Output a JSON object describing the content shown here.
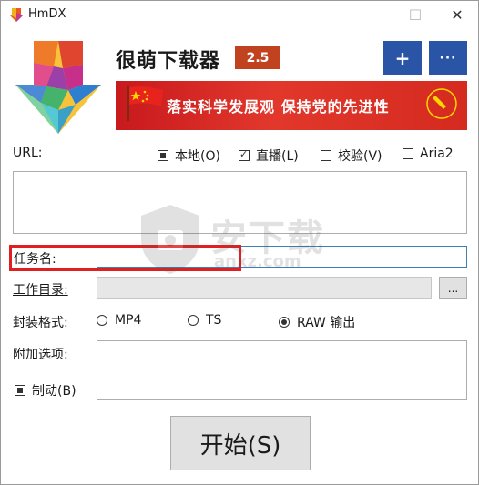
{
  "window": {
    "title": "HmDX",
    "minimize_glyph": "—",
    "maximize_glyph": "☐",
    "close_glyph": "✕"
  },
  "header": {
    "app_name": "很萌下载器",
    "version": "2.5",
    "plus_label": "+",
    "more_label": "···",
    "banner_text": "落实科学发展观 保持党的先进性"
  },
  "url": {
    "label": "URL:",
    "options": [
      {
        "label": "本地(O)",
        "state": "indeterminate"
      },
      {
        "label": "直播(L)",
        "state": "checked"
      },
      {
        "label": "校验(V)",
        "state": "unchecked"
      },
      {
        "label": "Aria2",
        "state": "unchecked"
      }
    ],
    "value": ""
  },
  "task": {
    "label": "任务名:",
    "value": ""
  },
  "workdir": {
    "label": "工作目录:",
    "value": "",
    "browse_label": "..."
  },
  "format": {
    "label": "封装格式:",
    "options": [
      {
        "label": "MP4",
        "selected": false
      },
      {
        "label": "TS",
        "selected": false
      },
      {
        "label": "RAW 输出",
        "selected": true
      }
    ]
  },
  "extra": {
    "label": "附加选项:",
    "value": "",
    "throttle_label": "制动(B)",
    "throttle_state": "indeterminate"
  },
  "start_label": "开始(S)",
  "watermark": {
    "main": "安下载",
    "sub": "anxz.com"
  },
  "colors": {
    "accent_blue": "#2a55a6",
    "version_badge": "#c0421f",
    "banner_red": "#d42a1f",
    "highlight": "#e02020"
  },
  "icons": [
    "app-logo-icon",
    "download-arrow-logo",
    "flag-icon",
    "party-emblem-icon"
  ]
}
